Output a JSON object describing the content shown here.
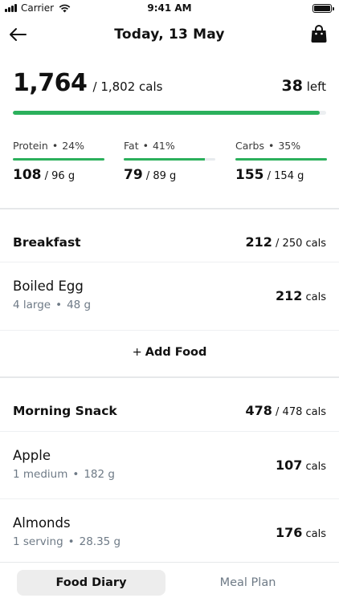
{
  "status_bar": {
    "carrier": "Carrier",
    "time": "9:41 AM"
  },
  "header": {
    "title": "Today, 13 May",
    "back_icon": "arrow-left-icon",
    "bag_icon": "shopping-bag-icon"
  },
  "calories": {
    "consumed": "1,764",
    "target": "/ 1,802 cals",
    "left_value": "38",
    "left_label": "left",
    "progress_fraction": 0.979
  },
  "macros": [
    {
      "name": "Protein",
      "percent": "24%",
      "value": "108",
      "target": "/ 96 g",
      "progress_fraction": 1.0
    },
    {
      "name": "Fat",
      "percent": "41%",
      "value": "79",
      "target": "/ 89 g",
      "progress_fraction": 0.888
    },
    {
      "name": "Carbs",
      "percent": "35%",
      "value": "155",
      "target": "/ 154 g",
      "progress_fraction": 1.0
    }
  ],
  "meals": {
    "breakfast": {
      "title": "Breakfast",
      "total_value": "212",
      "total_target": "/ 250 cals",
      "items": [
        {
          "name": "Boiled Egg",
          "quantity": "4 large",
          "weight": "48 g",
          "cals_value": "212",
          "cals_unit": "cals"
        }
      ],
      "add_label": "Add Food"
    },
    "morning_snack": {
      "title": "Morning Snack",
      "total_value": "478",
      "total_target": "/ 478 cals",
      "items": [
        {
          "name": "Apple",
          "quantity": "1 medium",
          "weight": "182 g",
          "cals_value": "107",
          "cals_unit": "cals"
        },
        {
          "name": "Almonds",
          "quantity": "1 serving",
          "weight": "28.35 g",
          "cals_value": "176",
          "cals_unit": "cals"
        }
      ]
    }
  },
  "tabs": {
    "food_diary": "Food Diary",
    "meal_plan": "Meal Plan"
  },
  "colors": {
    "accent_green": "#2bb05c",
    "muted_text": "#6e7a86"
  }
}
